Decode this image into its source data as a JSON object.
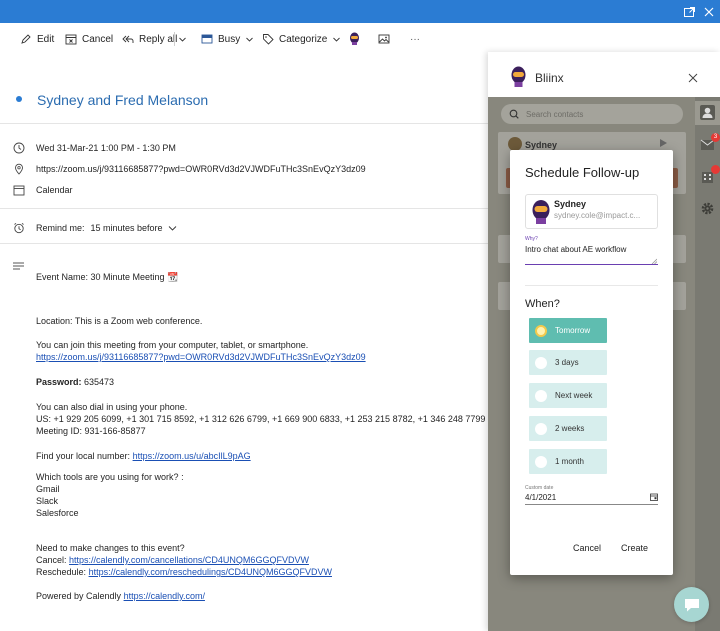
{
  "titlebar": {
    "popout_icon": "popout-icon",
    "close_icon": "close-icon",
    "color": "#2b7cd3"
  },
  "toolbar": {
    "edit": "Edit",
    "cancel": "Cancel",
    "reply_all": "Reply all",
    "busy": "Busy",
    "categorize": "Categorize",
    "more": "···"
  },
  "event": {
    "title": "Sydney and Fred Melanson",
    "datetime": "Wed 31-Mar-21 1:00 PM - 1:30 PM",
    "location": "https://zoom.us/j/93116685877?pwd=OWR0RVd3d2VJWDFuTHc3SnEvQzY3dz09",
    "calendar": "Calendar",
    "remind_label": "Remind me:",
    "remind_value": "15 minutes before"
  },
  "body": {
    "event_name": "Event Name: 30 Minute Meeting 📆",
    "location_line": "Location: This is a Zoom web conference.",
    "join_text": "You can join this meeting from your computer, tablet, or smartphone.",
    "join_link": "https://zoom.us/j/93116685877?pwd=OWR0RVd3d2VJWDFuTHc3SnEvQzY3dz09",
    "password_label": "Password:",
    "password_value": "635473",
    "dial_text": "You can also dial in using your phone.",
    "dial_us": "US: +1 929 205 6099, +1 301 715 8592, +1 312 626 6799, +1 669 900 6833, +1 253 215 8782, +1 346 248 7799",
    "meeting_id": "Meeting ID: 931-166-85877",
    "local_number_label": "Find your local number:",
    "local_number_link": "https://zoom.us/u/abcIlL9pAG",
    "tools_question": "Which tools are you using for work? :",
    "tools": [
      "Gmail",
      "Slack",
      "Salesforce"
    ],
    "changes_text": "Need to make changes to this event?",
    "cancel_label": "Cancel:",
    "cancel_link": "https://calendly.com/cancellations/CD4UNQM6GGQFVDVW",
    "reschedule_label": "Reschedule:",
    "reschedule_link": "https://calendly.com/reschedulings/CD4UNQM6GGQFVDVW",
    "powered_label": "Powered by Calendly",
    "powered_link": "https://calendly.com/"
  },
  "panel": {
    "title": "Bliinx",
    "search_placeholder": "Search contacts",
    "bg_contact_name": "Sydney",
    "mail_badge": "3",
    "accent": "#5fbdb0"
  },
  "modal": {
    "title": "Schedule Follow-up",
    "contact_name": "Sydney",
    "contact_email": "sydney.cole@impact.c...",
    "why_label": "Why?",
    "why_value": "Intro chat about AE workflow",
    "when_label": "When?",
    "options": [
      "Tomorrow",
      "3 days",
      "Next week",
      "2 weeks",
      "1 month"
    ],
    "selected_option": "Tomorrow",
    "custom_date_label": "Custom date",
    "custom_date_value": "4/1/2021",
    "cancel_label": "Cancel",
    "create_label": "Create"
  }
}
